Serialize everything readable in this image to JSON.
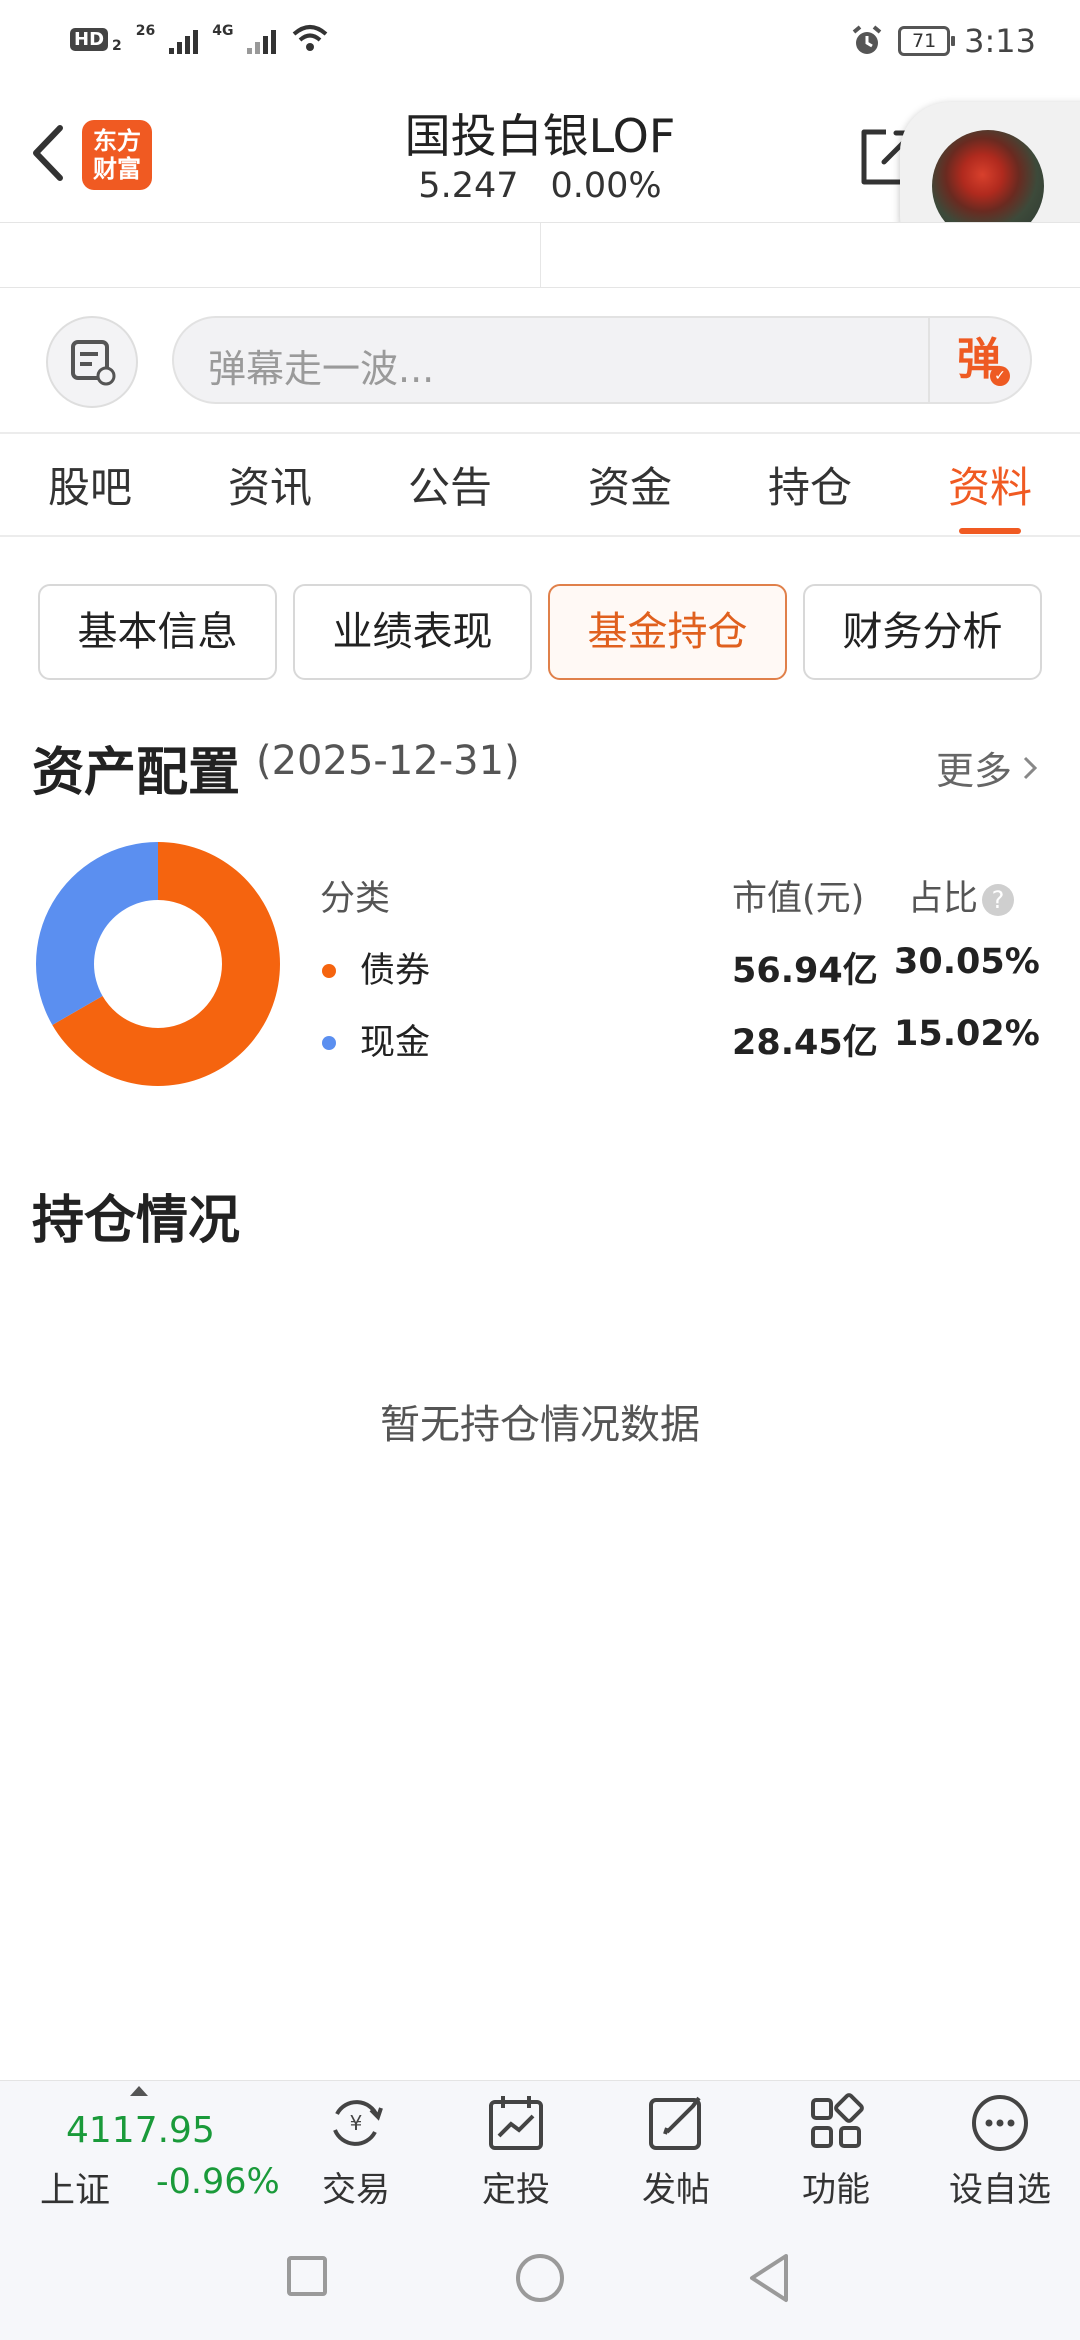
{
  "status_bar": {
    "hd_label": "HD",
    "hd_sub": "2",
    "net1": "26",
    "net2": "4G",
    "battery": "71",
    "time": "3:13"
  },
  "header": {
    "logo_line1": "东方",
    "logo_line2": "财富",
    "title": "国投白银LOF",
    "price": "5.247",
    "change": "0.00%"
  },
  "danmu": {
    "placeholder": "弹幕走一波...",
    "button": "弹"
  },
  "tabs": [
    {
      "label": "股吧"
    },
    {
      "label": "资讯"
    },
    {
      "label": "公告"
    },
    {
      "label": "资金"
    },
    {
      "label": "持仓"
    },
    {
      "label": "资料",
      "active": true
    }
  ],
  "chips": [
    {
      "label": "基本信息"
    },
    {
      "label": "业绩表现"
    },
    {
      "label": "基金持仓",
      "active": true
    },
    {
      "label": "财务分析"
    }
  ],
  "asset": {
    "title": "资产配置",
    "date": "(2025-12-31)",
    "more": "更多",
    "headers": {
      "category": "分类",
      "market_value": "市值(元)",
      "ratio": "占比"
    },
    "rows": [
      {
        "name": "债券",
        "market_value": "56.94亿",
        "ratio": "30.05%",
        "color": "#f5640f"
      },
      {
        "name": "现金",
        "market_value": "28.45亿",
        "ratio": "15.02%",
        "color": "#5b8ff0"
      }
    ]
  },
  "chart_data": {
    "type": "pie",
    "categories": [
      "债券",
      "现金"
    ],
    "values": [
      30.05,
      15.02
    ],
    "colors": [
      "#f5640f",
      "#5b8ff0"
    ],
    "title": "",
    "donut": true
  },
  "holdings": {
    "title": "持仓情况",
    "empty": "暂无持仓情况数据"
  },
  "toolbar": {
    "index_value": "4117.95",
    "index_name": "上证",
    "index_change": "-0.96%",
    "items": [
      {
        "label": "交易",
        "icon": "trade-icon"
      },
      {
        "label": "定投",
        "icon": "auto-invest-icon"
      },
      {
        "label": "发帖",
        "icon": "post-icon"
      },
      {
        "label": "功能",
        "icon": "apps-icon"
      },
      {
        "label": "设自选",
        "icon": "more-icon"
      }
    ]
  }
}
